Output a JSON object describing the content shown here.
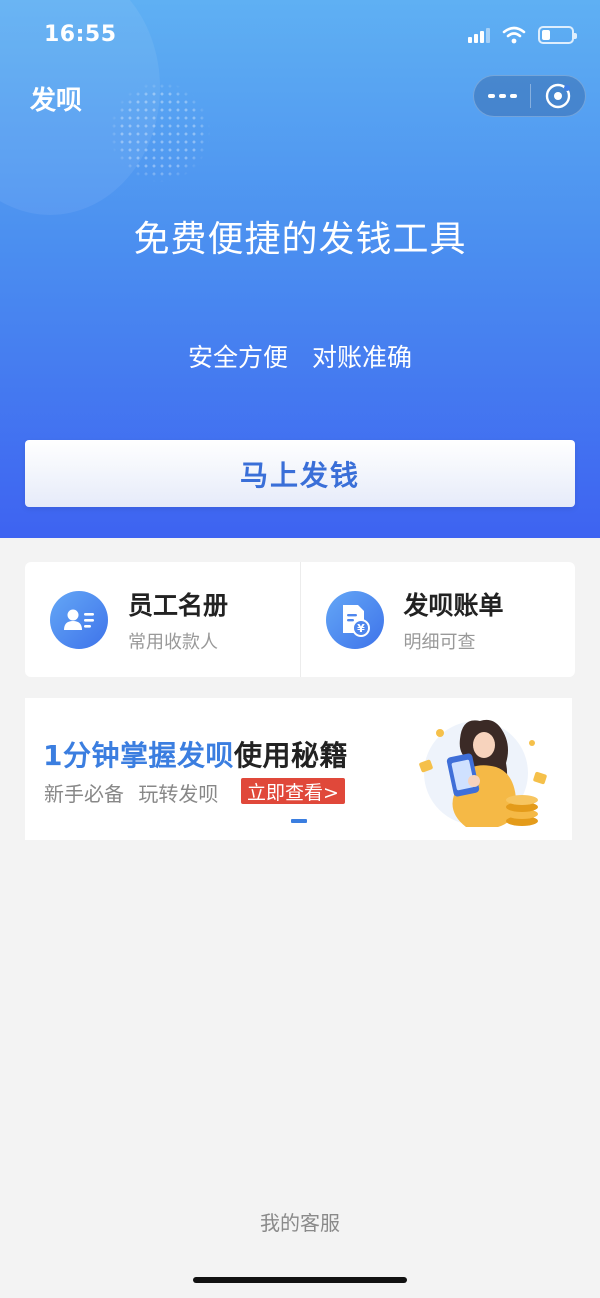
{
  "status_bar": {
    "time": "16:55",
    "icons": [
      "signal-icon",
      "wifi-icon",
      "battery-icon"
    ],
    "battery_level": 0.3
  },
  "nav": {
    "title": "发呗",
    "capsule_icons": [
      "more-icon",
      "close-miniprogram-icon"
    ]
  },
  "hero": {
    "headline": "免费便捷的发钱工具",
    "subtitle": "安全方便 对账准确",
    "cta_label": "马上发钱"
  },
  "features": [
    {
      "title": "员工名册",
      "desc": "常用收款人",
      "icon": "contacts-icon"
    },
    {
      "title": "发呗账单",
      "desc": "明细可查",
      "icon": "bill-icon"
    }
  ],
  "banner": {
    "title_highlight": "1分钟掌握发呗",
    "title_rest": "使用秘籍",
    "subline": "新手必备 玩转发呗",
    "button": "立即查看>",
    "illustration": "woman-with-phone-and-coins-illustration"
  },
  "footer": {
    "service_link": "我的客服"
  },
  "colors": {
    "hero_top": "#5fb0f3",
    "hero_bottom": "#3e63f1",
    "accent_blue": "#3b7ee0",
    "button_red": "#e0483a",
    "page_bg": "#f3f3f3"
  }
}
